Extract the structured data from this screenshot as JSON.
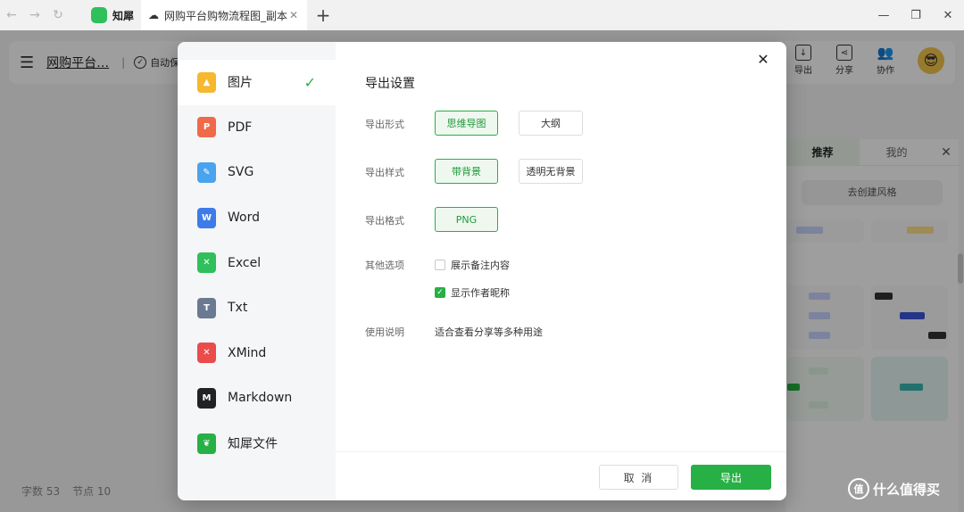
{
  "browser": {
    "app_tab_label": "知犀",
    "active_tab_label": "网购平台购物流程图_副本",
    "nav_back": "←",
    "nav_forward": "→",
    "nav_reload": "↻",
    "new_tab": "+",
    "tab_close": "✕",
    "win_minimize": "—",
    "win_restore": "❐",
    "win_close": "✕"
  },
  "app": {
    "menu_icon": "☰",
    "doc_title": "网购平台…",
    "separator": "|",
    "autosave_label": "自动保存",
    "toolbar_buttons": [
      {
        "label": "导出",
        "icon": "download-icon"
      },
      {
        "label": "分享",
        "icon": "share-icon"
      },
      {
        "label": "协作",
        "icon": "collab-icon"
      }
    ],
    "avatar": "😎",
    "status": {
      "word_count": "字数 53",
      "node_count": "节点 10"
    }
  },
  "style_panel": {
    "tabs": [
      "推荐",
      "我的"
    ],
    "close": "✕",
    "create_style": "去创建风格"
  },
  "dialog": {
    "close": "✕",
    "formats": [
      {
        "label": "图片",
        "icon": "image-icon",
        "color": "#f5b82e",
        "glyph": "▲",
        "selected": true
      },
      {
        "label": "PDF",
        "icon": "pdf-icon",
        "color": "#ef6a4a",
        "glyph": "P"
      },
      {
        "label": "SVG",
        "icon": "svg-icon",
        "color": "#4aa3ee",
        "glyph": "✎"
      },
      {
        "label": "Word",
        "icon": "word-icon",
        "color": "#3e7be8",
        "glyph": "W"
      },
      {
        "label": "Excel",
        "icon": "excel-icon",
        "color": "#2fbf5b",
        "glyph": "✕"
      },
      {
        "label": "Txt",
        "icon": "txt-icon",
        "color": "#6b7a90",
        "glyph": "T"
      },
      {
        "label": "XMind",
        "icon": "xmind-icon",
        "color": "#ea4c4c",
        "glyph": "✕"
      },
      {
        "label": "Markdown",
        "icon": "markdown-icon",
        "color": "#222222",
        "glyph": "M"
      },
      {
        "label": "知犀文件",
        "icon": "zhixi-file-icon",
        "color": "#27b045",
        "glyph": "❦"
      }
    ],
    "check": "✓",
    "title": "导出设置",
    "form": {
      "label": "导出形式",
      "options": [
        "思维导图",
        "大纲"
      ]
    },
    "style": {
      "label": "导出样式",
      "options": [
        "带背景",
        "透明无背景"
      ]
    },
    "format": {
      "label": "导出格式",
      "options": [
        "PNG"
      ]
    },
    "other": {
      "label": "其他选项",
      "options": [
        {
          "label": "展示备注内容",
          "checked": false
        },
        {
          "label": "显示作者昵称",
          "checked": true
        }
      ]
    },
    "usage": {
      "label": "使用说明",
      "text": "适合查看分享等多种用途"
    },
    "cancel_label": "取 消",
    "export_label": "导出"
  },
  "watermark": {
    "logo": "值",
    "text": "什么值得买"
  },
  "colors": {
    "accent": "#27b045"
  }
}
